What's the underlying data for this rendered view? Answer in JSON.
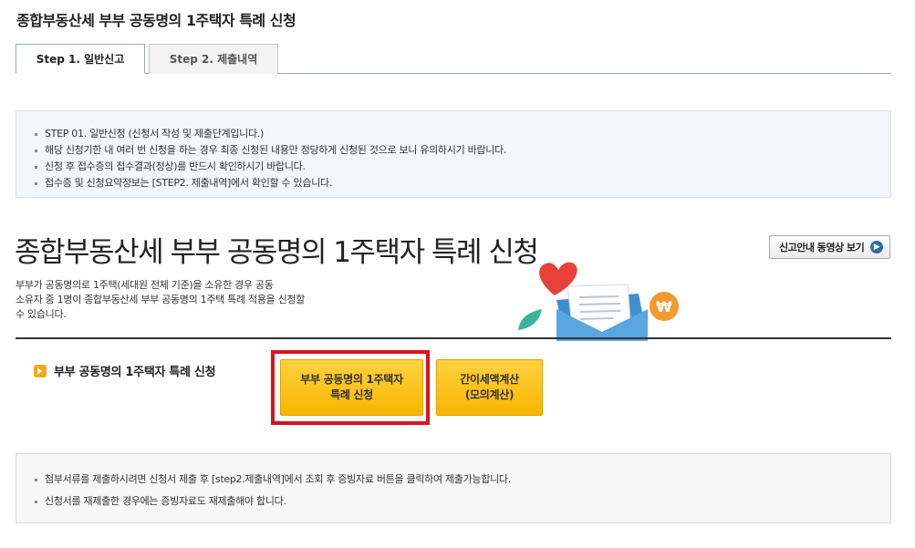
{
  "page": {
    "title": "종합부동산세 부부 공동명의 1주택자 특례 신청"
  },
  "tabs": [
    {
      "label": "Step 1. 일반신고",
      "active": true
    },
    {
      "label": "Step 2. 제출내역",
      "active": false
    }
  ],
  "notice_top": {
    "items": [
      "STEP 01. 일반신청 (신청서 작성 및 제출단계입니다.)",
      "해당 신청기한 내 여러 번 신청을 하는 경우 최종 신청된 내용만 정당하게 신청된 것으로 보니 유의하시기 바랍니다.",
      "신청 후 접수증의 접수결과(정상)를 반드시 확인하시기 바랍니다.",
      "접수증 및 신청요약정보는 [STEP2. 제출내역]에서 확인할 수 있습니다."
    ]
  },
  "hero": {
    "title": "종합부동산세 부부 공동명의 1주택자 특례 신청",
    "video_button": "신고안내 동영상 보기",
    "description_lines": [
      "부부가 공동명의로 1주택(세대원 전체 기준)을 소유한 경우 공동",
      "소유자 중 1명이 종합부동산세 부부 공동명의 1주택 특례 적용을 신청할",
      "수 있습니다."
    ],
    "illustration": {
      "heart_icon": "heart-icon",
      "letter_icon": "envelope-icon",
      "coin_icon": "won-coin-icon",
      "coin_symbol": "₩",
      "colors": {
        "heart": "#e8413c",
        "envelope": "#3d8fd1",
        "coin": "#f29a2e",
        "leaf": "#3ab59a"
      }
    }
  },
  "action_section": {
    "label": "부부 공동명의 1주택자 특례 신청",
    "apply_button": {
      "line1": "부부 공동명의 1주택자",
      "line2": "특례 신청"
    },
    "calc_button": {
      "line1": "간이세액계산",
      "line2": "(모의계산)"
    },
    "colors": {
      "button": "#f7b500",
      "highlight": "#d7141d"
    }
  },
  "notice_bottom": {
    "items": [
      "첨부서류를 제출하시려면 신청서 제출 후 [step2.제출내역]에서 조회 후 증빙자료 버튼을 클릭하여 제출가능합니다.",
      "신청서를 재제출한 경우에는 증빙자료도 재제출해야 합니다."
    ]
  }
}
